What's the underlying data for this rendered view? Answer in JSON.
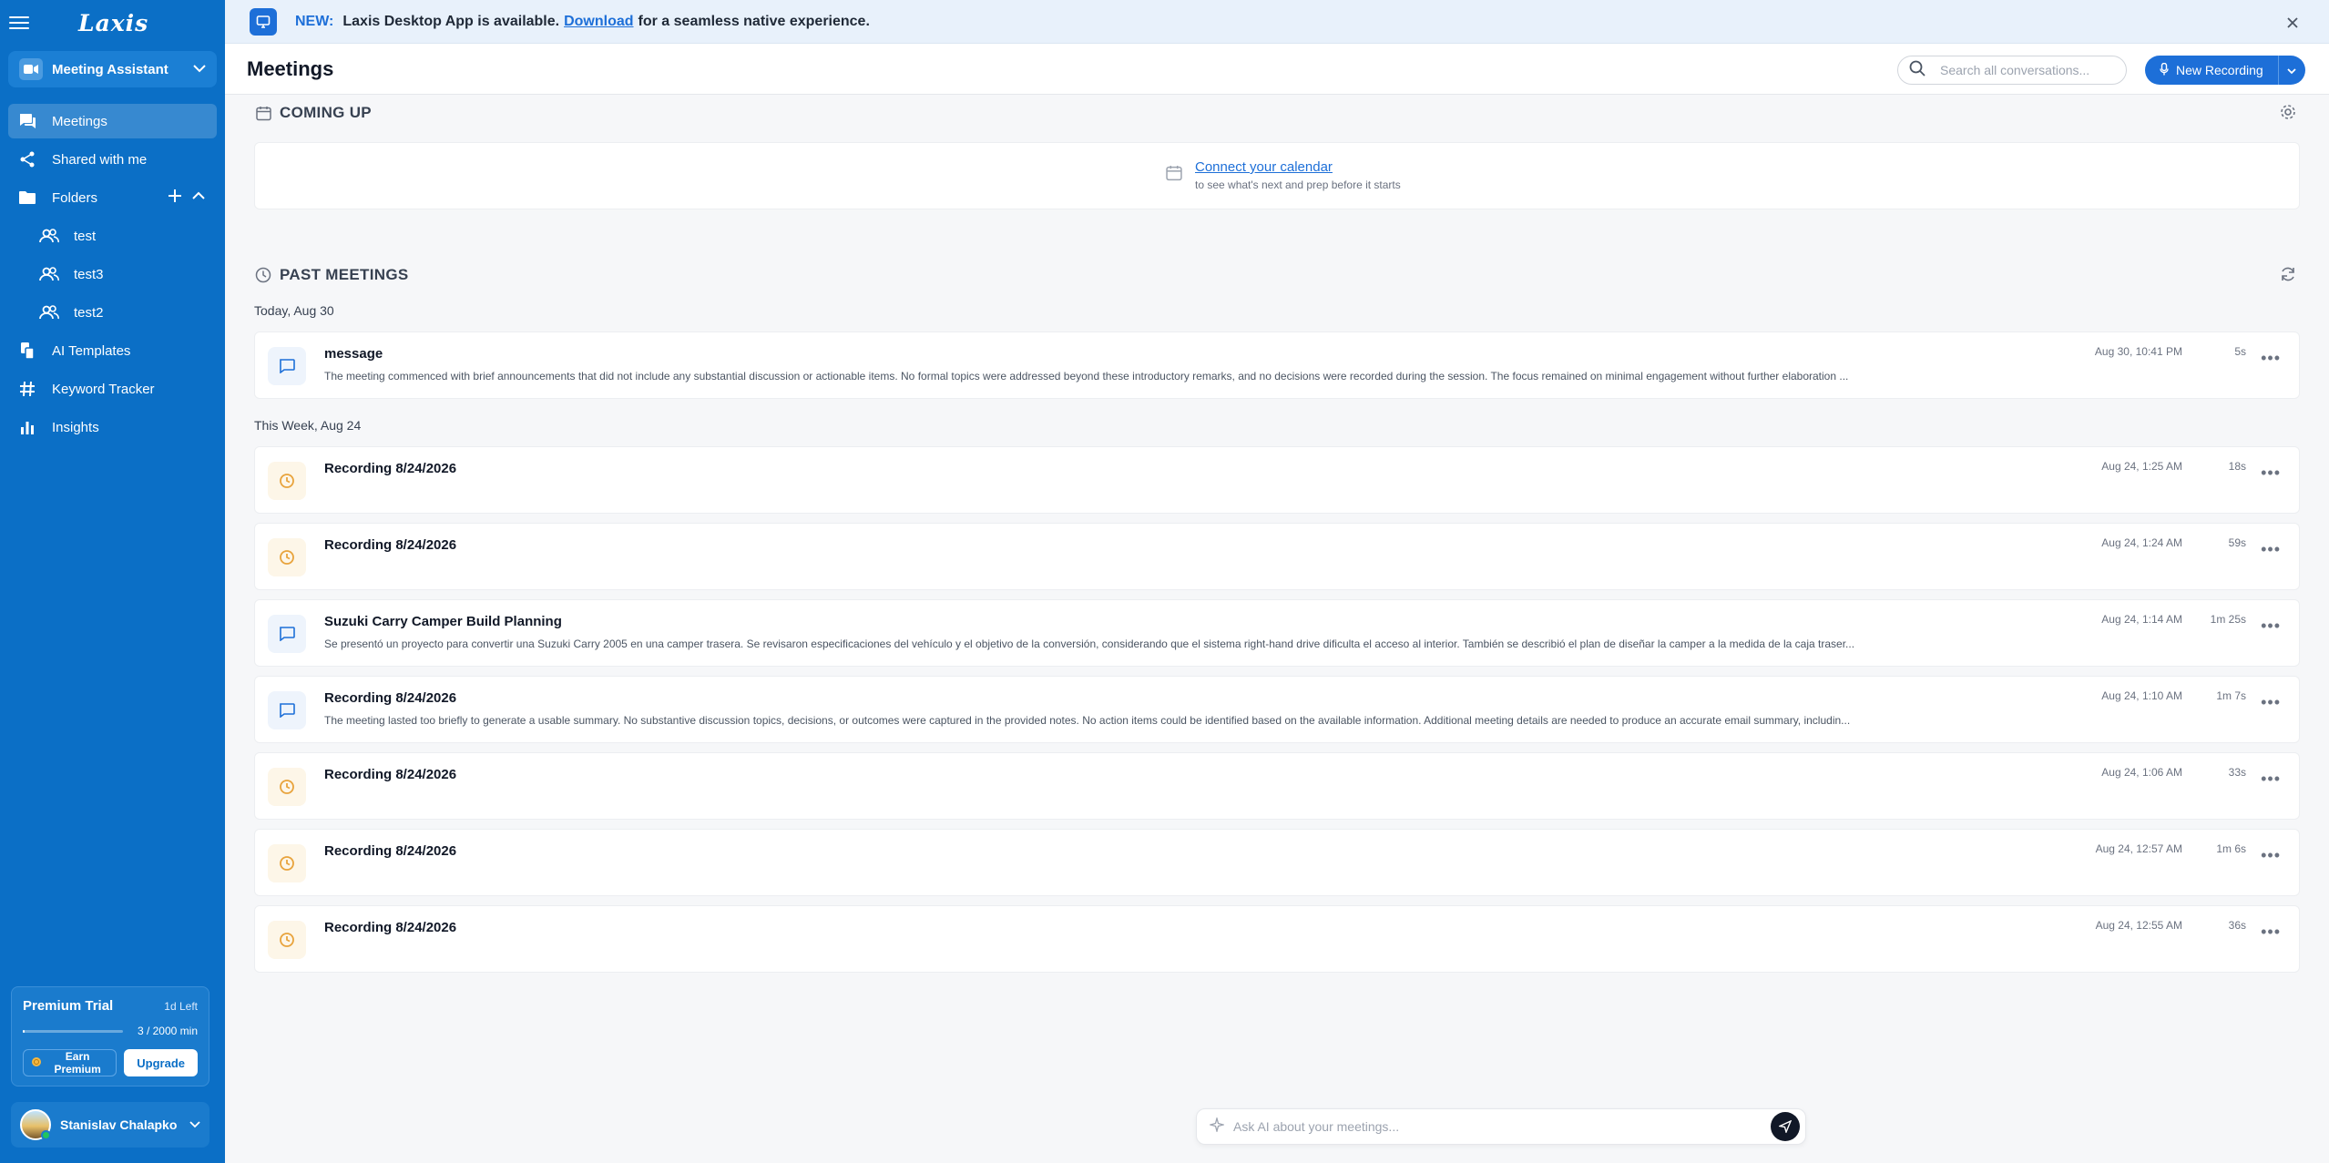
{
  "app": {
    "logo": "Laxis"
  },
  "sidebar": {
    "assistant_label": "Meeting Assistant",
    "items": [
      {
        "label": "Meetings",
        "icon": "chat-icon"
      },
      {
        "label": "Shared with me",
        "icon": "share-icon"
      },
      {
        "label": "Folders",
        "icon": "folder-icon"
      },
      {
        "label": "test",
        "icon": "people-icon"
      },
      {
        "label": "test3",
        "icon": "people-icon"
      },
      {
        "label": "test2",
        "icon": "people-icon"
      },
      {
        "label": "AI Templates",
        "icon": "templates-icon"
      },
      {
        "label": "Keyword Tracker",
        "icon": "hashtag-icon"
      },
      {
        "label": "Insights",
        "icon": "bar-chart-icon"
      }
    ],
    "trial": {
      "title": "Premium Trial",
      "days_left": "1d Left",
      "usage": "3 / 2000 min",
      "usage_fraction": 0.0015,
      "earn_label": "Earn Premium",
      "upgrade_label": "Upgrade"
    },
    "user_name": "Stanislav Chalapko"
  },
  "banner": {
    "new_label": "NEW:",
    "text": "Laxis Desktop App is available.",
    "link": "Download",
    "suffix": "for a seamless native experience."
  },
  "header": {
    "title": "Meetings",
    "search_placeholder": "Search all conversations...",
    "new_recording_label": "New Recording"
  },
  "coming_up": {
    "title": "COMING UP",
    "connect_link": "Connect your calendar",
    "connect_sub": "to see what's next and prep before it starts"
  },
  "past": {
    "title": "PAST MEETINGS",
    "groups": [
      {
        "label": "Today, Aug 30",
        "meetings": [
          {
            "type": "chat",
            "title": "message",
            "summary": "The meeting commenced with brief announcements that did not include any substantial discussion or actionable items. No formal topics were addressed beyond these introductory remarks, and no decisions were recorded during the session. The focus remained on minimal engagement without further elaboration ...",
            "date": "Aug 30, 10:41 PM",
            "duration": "5s"
          }
        ]
      },
      {
        "label": "This Week, Aug 24",
        "meetings": [
          {
            "type": "clock",
            "title": "Recording 8/24/2026",
            "summary": "",
            "date": "Aug 24, 1:25 AM",
            "duration": "18s"
          },
          {
            "type": "clock",
            "title": "Recording 8/24/2026",
            "summary": "",
            "date": "Aug 24, 1:24 AM",
            "duration": "59s"
          },
          {
            "type": "chat",
            "title": "Suzuki Carry Camper Build Planning",
            "summary": "Se presentó un proyecto para convertir una Suzuki Carry 2005 en una camper trasera. Se revisaron especificaciones del vehículo y el objetivo de la conversión, considerando que el sistema right-hand drive dificulta el acceso al interior. También se describió el plan de diseñar la camper a la medida de la caja traser...",
            "date": "Aug 24, 1:14 AM",
            "duration": "1m 25s"
          },
          {
            "type": "chat",
            "title": "Recording 8/24/2026",
            "summary": "The meeting lasted too briefly to generate a usable summary. No substantive discussion topics, decisions, or outcomes were captured in the provided notes. No action items could be identified based on the available information. Additional meeting details are needed to produce an accurate email summary, includin...",
            "date": "Aug 24, 1:10 AM",
            "duration": "1m 7s"
          },
          {
            "type": "clock",
            "title": "Recording 8/24/2026",
            "summary": "",
            "date": "Aug 24, 1:06 AM",
            "duration": "33s"
          },
          {
            "type": "clock",
            "title": "Recording 8/24/2026",
            "summary": "",
            "date": "Aug 24, 12:57 AM",
            "duration": "1m 6s"
          },
          {
            "type": "clock",
            "title": "Recording 8/24/2026",
            "summary": "",
            "date": "Aug 24, 12:55 AM",
            "duration": "36s"
          }
        ]
      }
    ]
  },
  "ask": {
    "placeholder": "Ask AI about your meetings..."
  },
  "colors": {
    "sidebar": "#0b6fc6",
    "accent": "#1d6fd8",
    "clock": "#e8a33c"
  }
}
